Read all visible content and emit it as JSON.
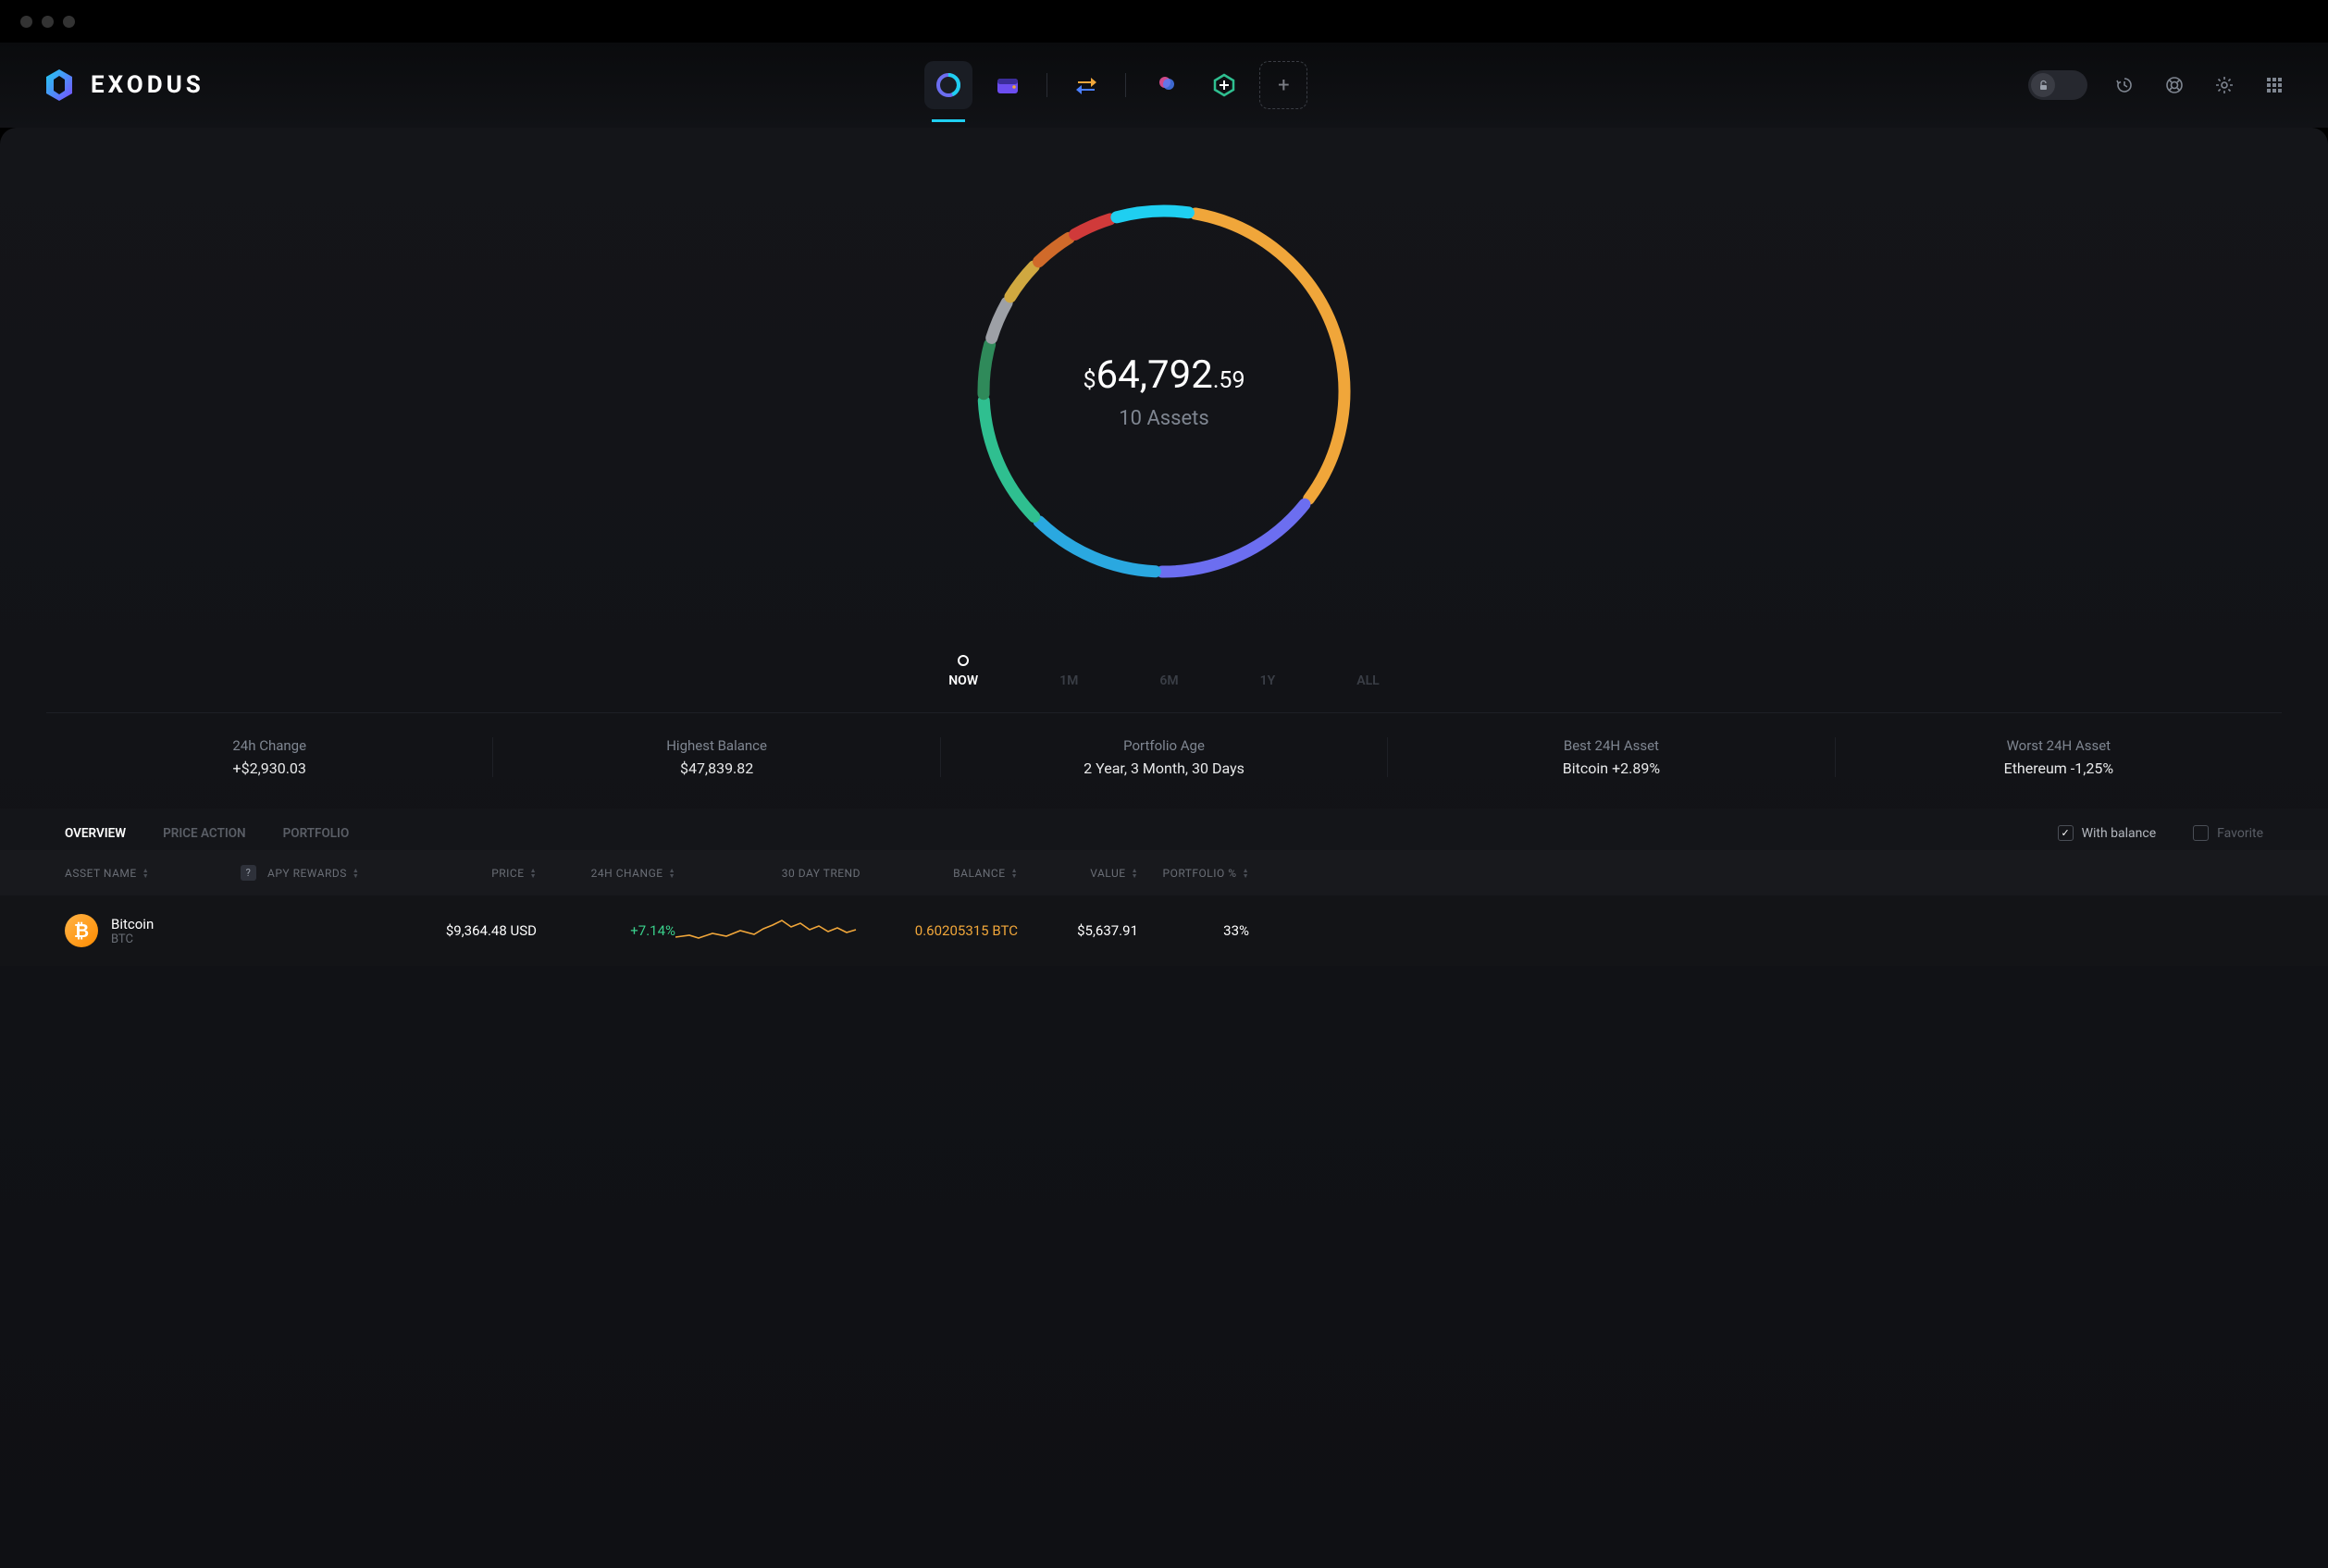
{
  "app": {
    "name": "EXODUS"
  },
  "nav": {
    "tiles": [
      "portfolio",
      "wallet",
      "exchange",
      "nft",
      "apps"
    ],
    "active": "portfolio"
  },
  "balance": {
    "currency": "$",
    "whole": "64,792",
    "cents": ".59",
    "assets_label": "10 Assets"
  },
  "ranges": {
    "items": [
      "NOW",
      "1M",
      "6M",
      "1Y",
      "ALL"
    ],
    "active": "NOW"
  },
  "stats": [
    {
      "label": "24h Change",
      "value": "+$2,930.03"
    },
    {
      "label": "Highest Balance",
      "value": "$47,839.82"
    },
    {
      "label": "Portfolio Age",
      "value": "2 Year, 3 Month, 30 Days"
    },
    {
      "label": "Best 24H Asset",
      "value": "Bitcoin +2.89%"
    },
    {
      "label": "Worst 24H Asset",
      "value": "Ethereum -1,25%"
    }
  ],
  "table_tabs": {
    "items": [
      "OVERVIEW",
      "PRICE ACTION",
      "PORTFOLIO"
    ],
    "active": "OVERVIEW",
    "with_balance_label": "With balance",
    "favorite_label": "Favorite",
    "with_balance_checked": true,
    "favorite_checked": false
  },
  "columns": {
    "asset_name": "ASSET NAME",
    "apy": "APY REWARDS",
    "price": "PRICE",
    "change": "24H CHANGE",
    "trend": "30 DAY TREND",
    "balance": "BALANCE",
    "value": "VALUE",
    "pct": "PORTFOLIO %"
  },
  "rows": [
    {
      "name": "Bitcoin",
      "symbol": "BTC",
      "price": "$9,364.48 USD",
      "change": "+7.14%",
      "balance": "0.60205315 BTC",
      "value": "$5,637.91",
      "pct": "33%"
    }
  ],
  "chart_data": {
    "type": "pie",
    "title": "Portfolio allocation",
    "slices": [
      {
        "name": "Bitcoin / Orange",
        "value": 33,
        "color": "#f0a63a"
      },
      {
        "name": "Purple/Indigo",
        "value": 15,
        "color": "#6c6ef0"
      },
      {
        "name": "Light Blue",
        "value": 12,
        "color": "#2aa8e0"
      },
      {
        "name": "Teal/Green",
        "value": 12,
        "color": "#2fbf90"
      },
      {
        "name": "Deep Green",
        "value": 5,
        "color": "#2f8a5a"
      },
      {
        "name": "Grey",
        "value": 4,
        "color": "#9da0a6"
      },
      {
        "name": "Gold",
        "value": 4,
        "color": "#d0a840"
      },
      {
        "name": "Dark Orange",
        "value": 4,
        "color": "#d06a2a"
      },
      {
        "name": "Red",
        "value": 4,
        "color": "#d03a3a"
      },
      {
        "name": "Cyan",
        "value": 7,
        "color": "#1fcff1"
      }
    ]
  }
}
